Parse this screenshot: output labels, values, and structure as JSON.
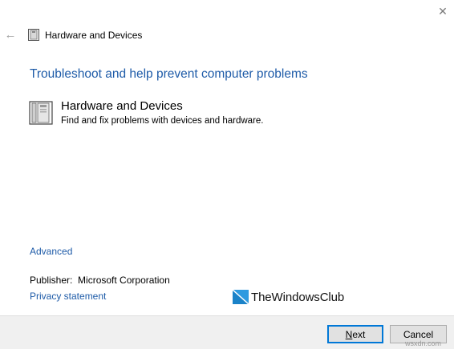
{
  "window": {
    "title": "Hardware and Devices",
    "close_icon": "close-icon",
    "back_icon": "back-arrow-icon"
  },
  "main": {
    "heading": "Troubleshoot and help prevent computer problems",
    "troubleshooter": {
      "title": "Hardware and Devices",
      "description": "Find and fix problems with devices and hardware.",
      "icon": "hardware-devices-icon"
    },
    "advanced_link": "Advanced",
    "publisher_label": "Publisher:",
    "publisher_value": "Microsoft Corporation",
    "privacy_link": "Privacy statement"
  },
  "watermark": {
    "text": "TheWindowsClub",
    "icon": "windows-logo-icon"
  },
  "footer": {
    "next_first": "N",
    "next_rest": "ext",
    "cancel": "Cancel"
  },
  "site_mark": "wsxdn.com",
  "colors": {
    "link_blue": "#1e5ba8",
    "accent": "#0078d7",
    "footer_bg": "#f0f0f0"
  }
}
